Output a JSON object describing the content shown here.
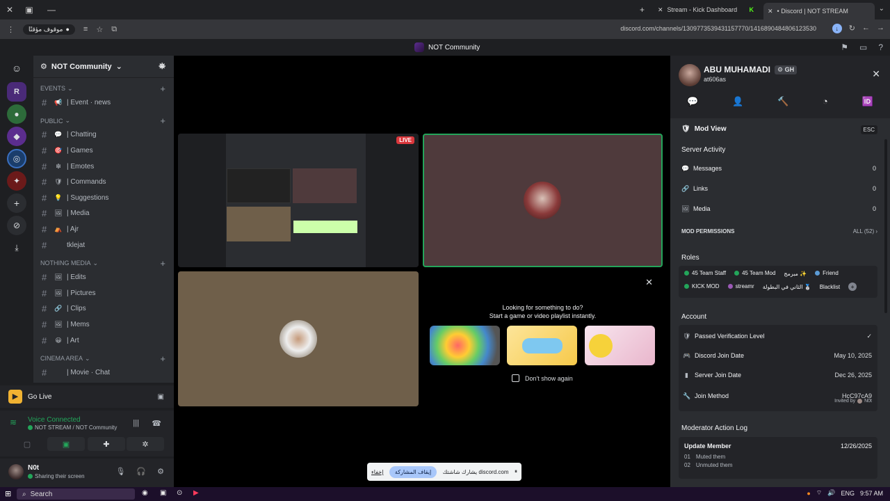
{
  "browser": {
    "tabs": [
      {
        "title": "Stream - Kick Dashboard"
      },
      {
        "title": "• Discord | NOT STREAM"
      }
    ],
    "profile_pill": "موقوف مؤقتًا",
    "url": "discord.com/channels/1309773539431157770/1416890484806123530"
  },
  "discord": {
    "window_title": "NOT Community",
    "server": {
      "name": "NOT Community",
      "categories": [
        {
          "name": "EVENTS",
          "channels": [
            {
              "icon": "📢",
              "name": "| Event · news"
            }
          ]
        },
        {
          "name": "PUBLIC",
          "channels": [
            {
              "icon": "💬",
              "name": "| Chatting"
            },
            {
              "icon": "🎯",
              "name": "| Games"
            },
            {
              "icon": "❇",
              "name": "| Emotes"
            },
            {
              "icon": "🛡",
              "name": "| Commands"
            },
            {
              "icon": "💡",
              "name": "| Suggestions"
            },
            {
              "icon": "🖼",
              "name": "| Media"
            },
            {
              "icon": "⛺",
              "name": "| Ajr"
            },
            {
              "icon": "",
              "name": "tklejat"
            }
          ]
        },
        {
          "name": "NOTHING Media",
          "channels": [
            {
              "icon": "🖼",
              "name": "| Edits"
            },
            {
              "icon": "🖼",
              "name": "| Pictures"
            },
            {
              "icon": "🔗",
              "name": "| Clips"
            },
            {
              "icon": "🖼",
              "name": "| Mems"
            },
            {
              "icon": "😀",
              "name": "| Art"
            }
          ]
        },
        {
          "name": "CINEMA AREA",
          "channels": [
            {
              "icon": "",
              "name": "| Movie · Chat"
            }
          ]
        }
      ]
    },
    "go_live": "Go Live",
    "voice": {
      "status": "Voice Connected",
      "channel": "NOT STREAM / NOT Community"
    },
    "user": {
      "name": "N0t",
      "status": "Sharing their screen"
    },
    "stage": {
      "live_badge": "LIVE",
      "activity_title_1": "Looking for something to do?",
      "activity_title_2": "Start a game or video playlist instantly.",
      "dont_show": "Don't show again"
    },
    "share_bar": {
      "message": "يشارك شاشتك discord.com",
      "stop": "إيقاف المشاركة",
      "hide": "إخفاء"
    },
    "profile": {
      "display_name": "ABU MUHAMADI",
      "tag": "GH",
      "username": "at606as",
      "mod_view": "Mod View",
      "esc": "ESC",
      "server_activity": "Server Activity",
      "activity": [
        {
          "icon": "💬",
          "label": "Messages",
          "value": "0"
        },
        {
          "icon": "🔗",
          "label": "Links",
          "value": "0"
        },
        {
          "icon": "🖼",
          "label": "Media",
          "value": "0"
        }
      ],
      "mod_permissions": "MOD PERMISSIONS",
      "all_perms": "ALL (52)",
      "roles_title": "Roles",
      "roles": [
        {
          "name": "45 Team Staff",
          "color": "#23a55a"
        },
        {
          "name": "45 Team Mod",
          "color": "#23a55a"
        },
        {
          "name": "مبرمج ✨",
          "color": ""
        },
        {
          "name": "Friend",
          "color": "#5b9bd5"
        },
        {
          "name": "KICK MOD",
          "color": "#23a55a"
        },
        {
          "name": "streamr",
          "color": "#9b59b6"
        },
        {
          "name": "الثاني في البطولة 🥈",
          "color": ""
        },
        {
          "name": "Blacklist",
          "color": ""
        }
      ],
      "account_title": "Account",
      "account": [
        {
          "icon": "🛡",
          "label": "Passed Verification Level",
          "value": "✓"
        },
        {
          "icon": "🎮",
          "label": "Discord Join Date",
          "value": "May 10, 2025"
        },
        {
          "icon": "▮",
          "label": "Server Join Date",
          "value": "Dec 26, 2025"
        },
        {
          "icon": "🔧",
          "label": "Join Method",
          "value": "HcC97cA9"
        }
      ],
      "invited_by": "Invited by",
      "invited_user": "N0t",
      "log_title": "Moderator Action Log",
      "log": {
        "action": "Update Member",
        "date": "12/26/2025",
        "items": [
          {
            "n": "01",
            "text": "Muted them"
          },
          {
            "n": "02",
            "text": "Unmuted them"
          }
        ]
      }
    }
  },
  "taskbar": {
    "search": "Search",
    "lang": "ENG",
    "time": "9:57 AM"
  }
}
